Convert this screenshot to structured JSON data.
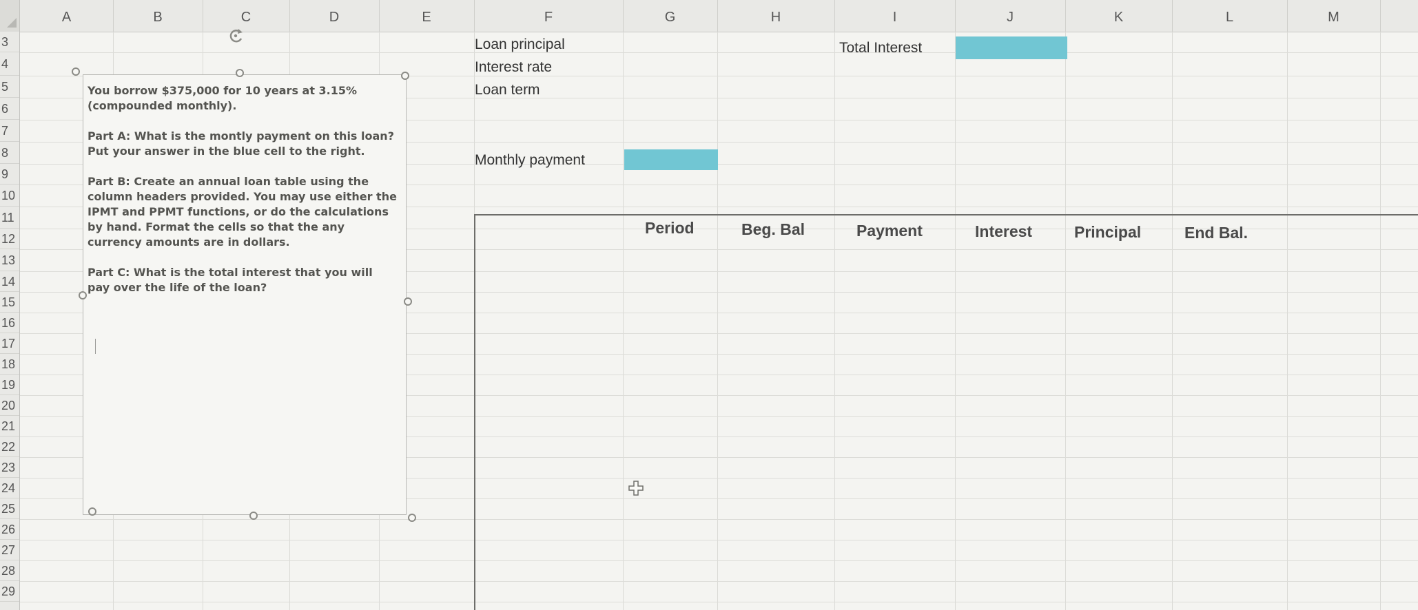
{
  "columns": [
    "A",
    "B",
    "C",
    "D",
    "E",
    "F",
    "G",
    "H",
    "I",
    "J",
    "K",
    "L",
    "M"
  ],
  "rows": [
    "3",
    "4",
    "5",
    "6",
    "7",
    "8",
    "9",
    "10",
    "11",
    "12",
    "13",
    "14",
    "15",
    "16",
    "17",
    "18",
    "19",
    "20",
    "21",
    "22",
    "23",
    "24",
    "25",
    "26",
    "27",
    "28",
    "29"
  ],
  "cells": {
    "loan_principal": "Loan principal",
    "interest_rate": "Interest rate",
    "loan_term": "Loan term",
    "monthly_payment": "Monthly payment",
    "total_interest": "Total Interest"
  },
  "table_headers": [
    "Period",
    "Beg. Bal",
    "Payment",
    "Interest",
    "Principal",
    "End Bal."
  ],
  "textbox": {
    "intro": "You borrow $375,000 for 10 years at 3.15% (compounded monthly).",
    "part_a": "Part A: What is the montly payment on this loan? Put your answer in the blue cell to the right.",
    "part_b": "Part B: Create an annual loan table using the column headers provided. You may use either the IPMT and PPMT functions, or do the calculations by hand. Format the cells so that the any currency amounts are in dollars.",
    "part_c": "Part C: What is the total interest that you will pay over the life of the loan?"
  },
  "colors": {
    "answer_cell": "#71c6d3",
    "background": "#f4f4f1"
  },
  "icons": [
    "rotate-handle-icon",
    "cell-cursor-icon"
  ]
}
